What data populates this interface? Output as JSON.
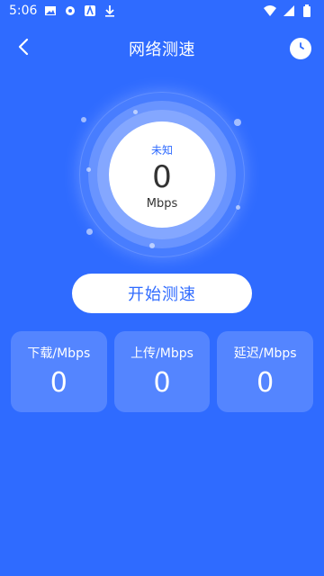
{
  "status_bar": {
    "time": "5:06",
    "left_icons": [
      "image-icon",
      "settings-gear-icon",
      "a-icon",
      "download-icon"
    ],
    "right_icons": [
      "wifi-icon",
      "signal-icon",
      "battery-icon"
    ]
  },
  "header": {
    "title": "网络测速",
    "back_icon": "chevron-left-icon",
    "history_icon": "clock-icon"
  },
  "gauge": {
    "status": "未知",
    "value": "0",
    "unit": "Mbps"
  },
  "actions": {
    "start_label": "开始测速"
  },
  "stats": [
    {
      "label": "下载/Mbps",
      "value": "0"
    },
    {
      "label": "上传/Mbps",
      "value": "0"
    },
    {
      "label": "延迟/Mbps",
      "value": "0"
    }
  ],
  "colors": {
    "background": "#2f6bff",
    "accent": "#2f6bff",
    "text_dark": "#333333"
  }
}
